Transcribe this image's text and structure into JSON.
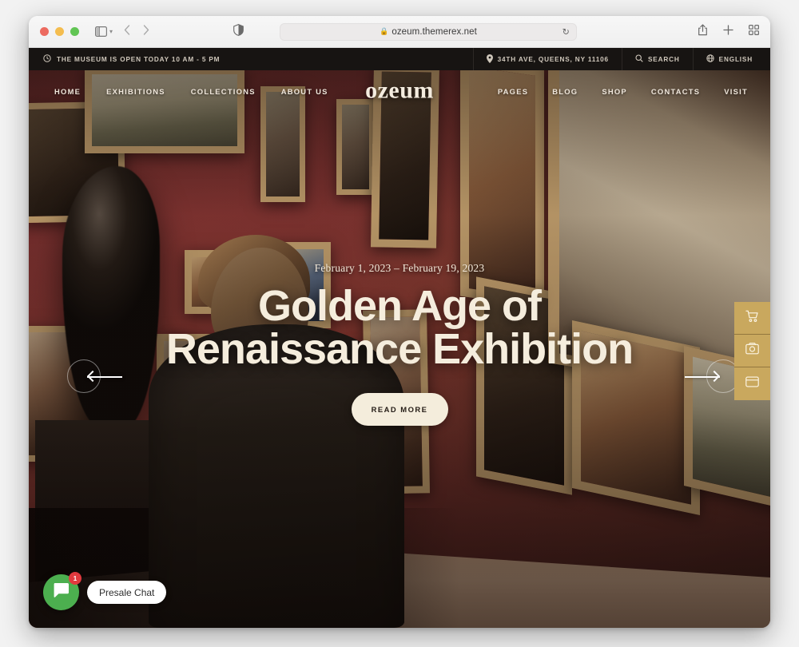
{
  "browser": {
    "url": "ozeum.themerex.net",
    "lock_icon": "lock-icon",
    "reload_icon": "reload-icon",
    "sidebar_icon": "sidebar-toggle-icon",
    "shield_icon": "privacy-shield-icon",
    "back_icon": "back-arrow-icon",
    "forward_icon": "forward-arrow-icon",
    "share_icon": "share-icon",
    "newtab_icon": "plus-icon",
    "tabs_icon": "tab-overview-icon"
  },
  "topbar": {
    "hours": "THE MUSEUM IS OPEN TODAY 10 AM - 5 PM",
    "hours_icon": "clock-icon",
    "address": "34TH AVE, QUEENS, NY 11106",
    "address_icon": "location-pin-icon",
    "search": "SEARCH",
    "search_icon": "search-icon",
    "language": "ENGLISH",
    "language_icon": "globe-icon",
    "background": "#171412"
  },
  "nav": {
    "logo": "ozeum",
    "left": [
      {
        "label": "HOME"
      },
      {
        "label": "EXHIBITIONS"
      },
      {
        "label": "COLLECTIONS"
      },
      {
        "label": "ABOUT US"
      }
    ],
    "right": [
      {
        "label": "PAGES"
      },
      {
        "label": "BLOG"
      },
      {
        "label": "SHOP"
      },
      {
        "label": "CONTACTS"
      },
      {
        "label": "VISIT"
      }
    ]
  },
  "hero": {
    "dates": "February 1, 2023 – February 19, 2023",
    "title": "Golden Age of Renaissance Exhibition",
    "cta": "READ MORE",
    "prev_arrow_icon": "arrow-left-icon",
    "next_arrow_icon": "arrow-right-icon",
    "text_color": "#f5eddd"
  },
  "side_widgets": {
    "accent": "#c9a85e",
    "items": [
      {
        "icon": "shopping-cart-icon"
      },
      {
        "icon": "image-gallery-icon"
      },
      {
        "icon": "window-card-icon"
      }
    ]
  },
  "chat": {
    "label": "Presale Chat",
    "badge": "1",
    "bubble_color": "#4caf4f",
    "badge_color": "#e0393e",
    "icon": "chat-bubble-icon"
  }
}
